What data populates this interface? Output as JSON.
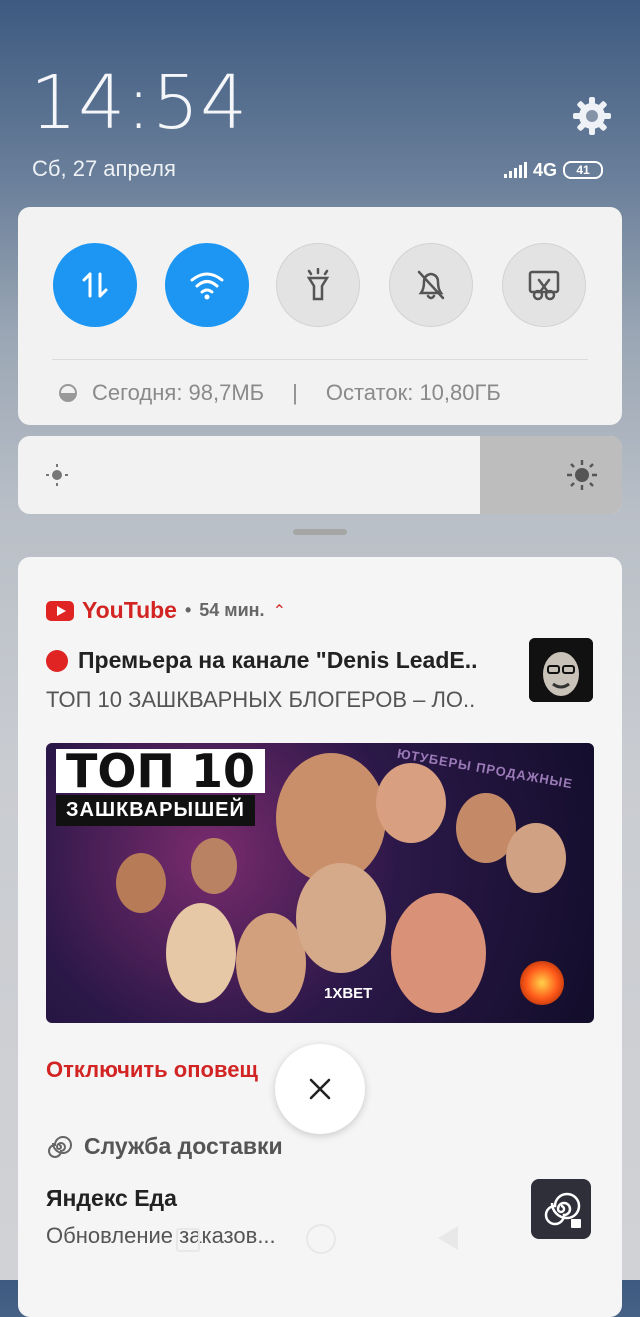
{
  "status": {
    "time": "14:54",
    "date": "Сб, 27 апреля",
    "network": "4G",
    "battery": "41"
  },
  "quick_settings": {
    "toggles": [
      {
        "name": "mobile-data",
        "icon": "data-transfer-icon",
        "on": true
      },
      {
        "name": "wifi",
        "icon": "wifi-icon",
        "on": true
      },
      {
        "name": "flashlight",
        "icon": "flashlight-icon",
        "on": false
      },
      {
        "name": "silent",
        "icon": "bell-off-icon",
        "on": false
      },
      {
        "name": "screenshot",
        "icon": "scissors-icon",
        "on": false
      }
    ],
    "usage_today": "Сегодня: 98,7МБ",
    "separator": "|",
    "usage_remaining": "Остаток: 10,80ГБ"
  },
  "brightness": {
    "level": 0.77
  },
  "notifications": {
    "youtube": {
      "app_name": "YouTube",
      "time": "54 мин.",
      "title": "Премьера на канале \"Denis LeadE..",
      "subtitle": "ТОП 10 ЗАШКВАРНЫХ БЛОГЕРОВ – ЛО..",
      "thumbnail_title": "ТОП 10",
      "thumbnail_subtitle": "ЗАШКВАРЫШЕЙ",
      "thumbnail_tag": "ЮТУБЕРЫ ПРОДАЖНЫЕ",
      "thumbnail_brand": "1XBET",
      "action": "Отключить оповещ"
    },
    "delivery": {
      "app_name": "Служба доставки",
      "title": "Яндекс Еда",
      "subtitle": "Обновление заказов..."
    }
  },
  "colors": {
    "accent": "#1c96f2",
    "youtube_red": "#d32424"
  }
}
